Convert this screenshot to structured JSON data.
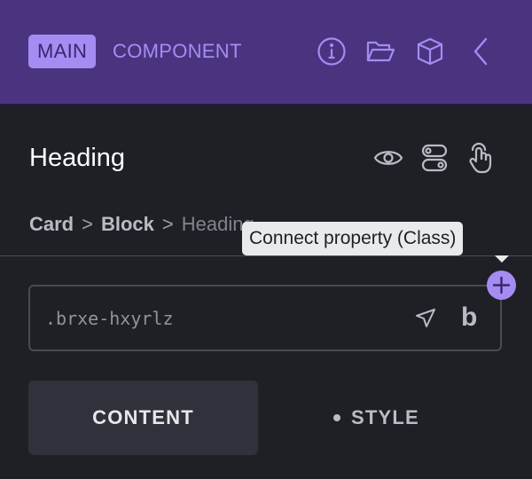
{
  "header": {
    "badge": "MAIN",
    "title": "COMPONENT",
    "icons": [
      "info-icon",
      "folder-open-icon",
      "cube-icon",
      "chevron-left-icon"
    ]
  },
  "element": {
    "title": "Heading",
    "icons": [
      "eye-icon",
      "toggle-icon",
      "hand-pointer-icon"
    ]
  },
  "breadcrumb": {
    "items": [
      "Card",
      "Block"
    ],
    "current": "Heading",
    "separator": ">"
  },
  "tooltip": {
    "text": "Connect property (Class)"
  },
  "class_field": {
    "value": ".brxe-hxyrlz",
    "bold_label": "b"
  },
  "tabs": [
    {
      "label": "CONTENT",
      "active": true
    },
    {
      "label": "STYLE",
      "active": false
    }
  ],
  "colors": {
    "header_bg": "#4a3480",
    "accent": "#a58cf2",
    "panel_bg": "#1e2026",
    "active_tab_bg": "#2f323a"
  }
}
